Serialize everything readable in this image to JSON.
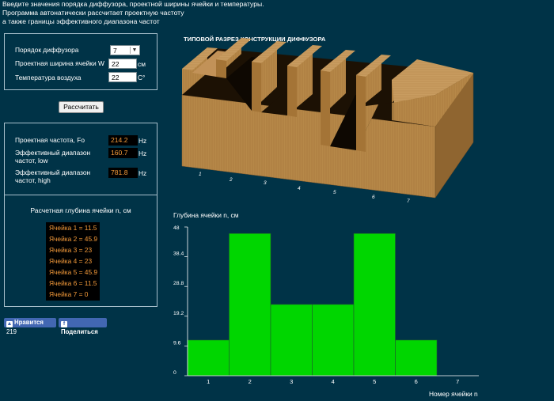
{
  "intro": [
    "Введите значения порядка диффузора, проектной ширины ячейки и температуры.",
    "Программа автонатически рассчитает проектную частоту",
    "а также границы эффективного диапазона частот"
  ],
  "form": {
    "order_label": "Порядок диффузора",
    "order_value": "7",
    "width_label": "Проектная ширина ячейки W",
    "width_value": "22",
    "width_unit": "см",
    "temp_label": "Температура воздуха",
    "temp_value": "22",
    "temp_unit": "C°",
    "calc_button": "Рассчитать"
  },
  "results": {
    "fo_label": "Проектная частота, Fo",
    "fo_value": "214.2",
    "low_label_1": "Эффективный диапазон",
    "low_label_2": "частот, low",
    "low_value": "160.7",
    "high_label_1": "Эффективный диапазон",
    "high_label_2": "частот, high",
    "high_value": "781.8",
    "unit": "Hz",
    "cells_title": "Расчетная глубина ячейки n, см",
    "cells": [
      "Ячейка 1 = 11.5",
      "Ячейка 2 = 45.9",
      "Ячейка 3 = 23",
      "Ячейка 4 = 23",
      "Ячейка 5 = 45.9",
      "Ячейка 6 = 11.5",
      "Ячейка 7 = 0"
    ]
  },
  "social": {
    "like_label": "Нравится",
    "like_count": "219",
    "share_label": "Поделиться"
  },
  "diagram": {
    "title": "ТИПОВОЙ РАЗРЕЗ КОНСТРУКЦИИ ДИФФУЗОРА",
    "labels": [
      "1",
      "2",
      "3",
      "4",
      "5",
      "6",
      "7"
    ]
  },
  "chart_data": {
    "type": "bar",
    "title": "Глубина ячейки n, см",
    "xlabel": "Номер ячейки n",
    "ylabel": "",
    "categories": [
      "1",
      "2",
      "3",
      "4",
      "5",
      "6",
      "7"
    ],
    "values": [
      11.5,
      45.9,
      23,
      23,
      45.9,
      11.5,
      0
    ],
    "ylim": [
      0,
      48
    ],
    "yticks": [
      "0",
      "9.6",
      "19.2",
      "28.8",
      "38.4",
      "48"
    ],
    "bar_color": "#00d600",
    "grid": false
  },
  "colors": {
    "background": "#003347",
    "output_text": "#f59b3a",
    "wood_top": "#c79a5d",
    "wood_front": "#b58747",
    "wood_dark": "#1e1204"
  }
}
